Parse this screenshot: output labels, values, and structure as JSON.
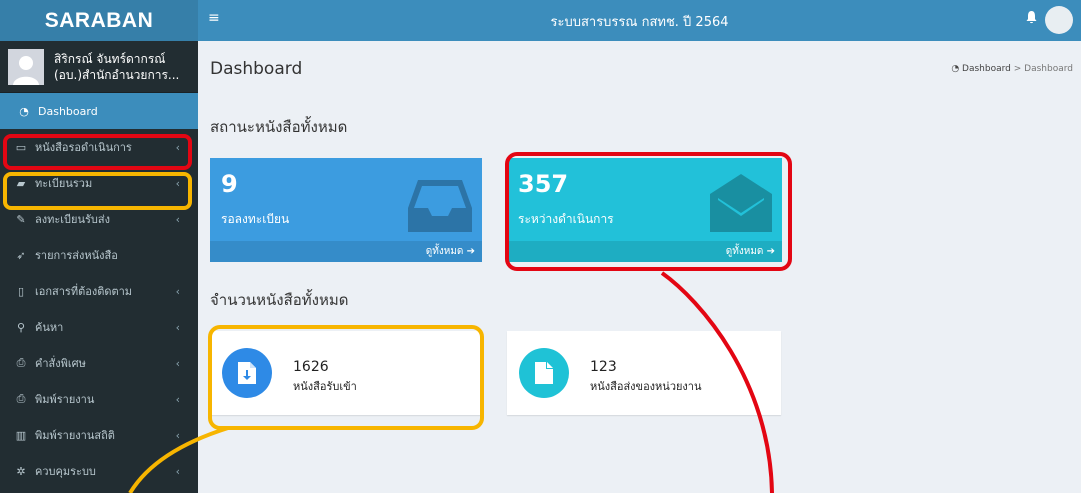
{
  "app": {
    "logo": "SARABAN",
    "title": "ระบบสารบรรณ กสทช. ปี 2564"
  },
  "user": {
    "name": "สิริกรณ์ จันทร์ดากรณ์",
    "org": "(อบ.)สำนักอำนวยการ..."
  },
  "sidebar": {
    "items": [
      {
        "label": "Dashboard",
        "icon": "dashboard-icon"
      },
      {
        "label": "หนังสือรอดำเนินการ",
        "icon": "inbox-icon"
      },
      {
        "label": "ทะเบียนรวม",
        "icon": "book-icon"
      },
      {
        "label": "ลงทะเบียนรับส่ง",
        "icon": "edit-icon"
      },
      {
        "label": "รายการส่งหนังสือ",
        "icon": "send-icon"
      },
      {
        "label": "เอกสารที่ต้องติดตาม",
        "icon": "bookmark-icon"
      },
      {
        "label": "ค้นหา",
        "icon": "search-icon"
      },
      {
        "label": "คำสั่งพิเศษ",
        "icon": "print-icon"
      },
      {
        "label": "พิมพ์รายงาน",
        "icon": "print-icon"
      },
      {
        "label": "พิมพ์รายงานสถิติ",
        "icon": "bar-chart-icon"
      },
      {
        "label": "ควบคุมระบบ",
        "icon": "gear-icon"
      }
    ]
  },
  "page": {
    "title": "Dashboard",
    "breadcrumb_home": "Dashboard",
    "breadcrumb_sep": ">",
    "breadcrumb_current": "Dashboard"
  },
  "status_section": {
    "title": "สถานะหนังสือทั้งหมด",
    "boxes": [
      {
        "value": "9",
        "label": "รอลงทะเบียน",
        "footer": "ดูทั้งหมด ➔",
        "color": "#3c9ce0"
      },
      {
        "value": "357",
        "label": "ระหว่างดำเนินการ",
        "footer": "ดูทั้งหมด ➔",
        "color": "#22c1d9"
      }
    ]
  },
  "count_section": {
    "title": "จำนวนหนังสือทั้งหมด",
    "boxes": [
      {
        "value": "1626",
        "label": "หนังสือรับเข้า",
        "color": "#2e8ae6"
      },
      {
        "value": "123",
        "label": "หนังสือส่งของหน่วยงาน",
        "color": "#1fc2d6"
      }
    ]
  },
  "colors": {
    "annotation_red": "#e30613",
    "annotation_yellow": "#f7b500"
  }
}
